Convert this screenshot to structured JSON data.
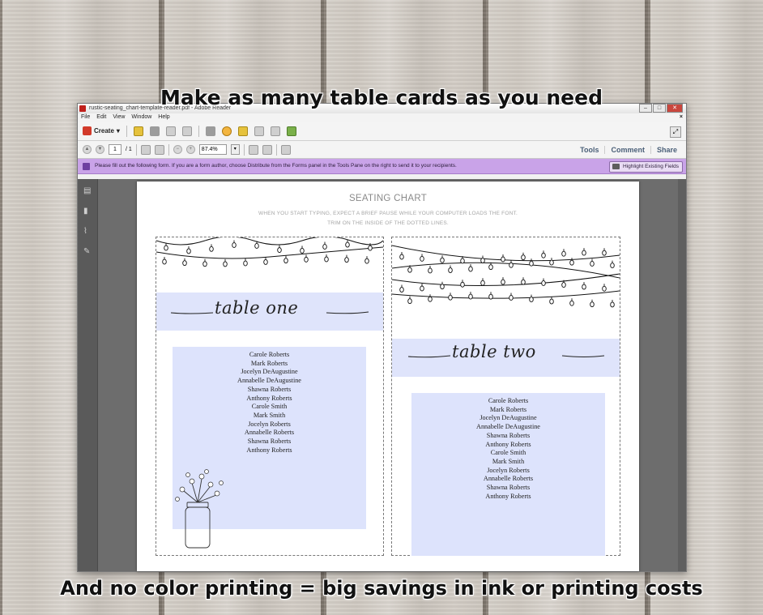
{
  "captions": {
    "top": "Make as many table cards as you need",
    "bottom": "And no color printing = big savings in ink or printing costs"
  },
  "window": {
    "title": "rustic-seating_chart-template-reader.pdf - Adobe Reader",
    "menu": [
      "File",
      "Edit",
      "View",
      "Window",
      "Help"
    ],
    "create_label": "Create",
    "page_current": "1",
    "page_total": "/ 1",
    "zoom": "87.4%",
    "tools_label": "Tools",
    "comment_label": "Comment",
    "share_label": "Share",
    "form_message": "Please fill out the following form. If you are a form author, choose Distribute from the Forms panel in the Tools Pane on the right to send it to your recipients.",
    "highlight_label": "Highlight Existing Fields"
  },
  "document": {
    "title": "SEATING CHART",
    "subtitle1": "WHEN YOU START TYPING, EXPECT A BRIEF PAUSE WHILE YOUR COMPUTER LOADS THE FONT.",
    "subtitle2": "TRIM ON THE INSIDE OF THE DOTTED LINES.",
    "cards": [
      {
        "table_name": "table one",
        "guests": [
          "Carole Roberts",
          "Mark Roberts",
          "Jocelyn DeAugustine",
          "Annabelle DeAugustine",
          "Shawna Roberts",
          "Anthony Roberts",
          "Carole Smith",
          "Mark Smith",
          "Jocelyn Roberts",
          "Annabelle Roberts",
          "Shawna Roberts",
          "Anthony Roberts"
        ]
      },
      {
        "table_name": "table two",
        "guests": [
          "Carole Roberts",
          "Mark Roberts",
          "Jocelyn DeAugustine",
          "Annabelle DeAugustine",
          "Shawna Roberts",
          "Anthony Roberts",
          "Carole Smith",
          "Mark Smith",
          "Jocelyn Roberts",
          "Annabelle Roberts",
          "Shawna Roberts",
          "Anthony Roberts"
        ]
      }
    ]
  },
  "colors": {
    "card_band": "#dfe4fb",
    "form_bar": "#c9a3e8",
    "acrobat_red": "#c0201b"
  }
}
